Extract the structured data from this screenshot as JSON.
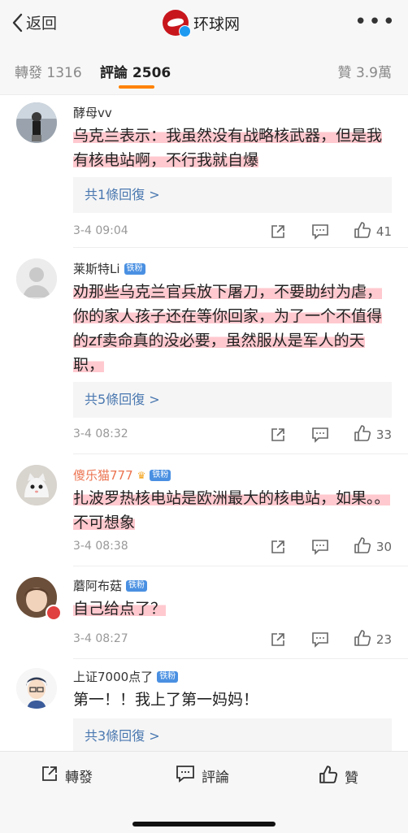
{
  "topbar": {
    "back_label": "返回",
    "brand": "环球网",
    "more": "•••"
  },
  "tabs": {
    "repost": "轉發 1316",
    "comments": "評論 2506",
    "likes": "贊 3.9萬"
  },
  "comments": [
    {
      "user": "酵母vv",
      "text": "乌克兰表示：我虽然没有战略核武器，但是我有核电站啊，不行我就自爆",
      "replies": "共1條回復 >",
      "time": "3-4 09:04",
      "likes": "41"
    },
    {
      "user": "莱斯特Li",
      "badge": "铁粉",
      "text": "劝那些乌克兰官兵放下屠刀，不要助纣为虐，你的家人孩子还在等你回家，为了一个不值得的zf卖命真的没必要，虽然服从是军人的天职，",
      "replies": "共5條回復 >",
      "time": "3-4 08:32",
      "likes": "33"
    },
    {
      "user": "傻乐猫777",
      "badge": "铁粉",
      "text": "扎波罗热核电站是欧洲最大的核电站，如果。。不可想象",
      "time": "3-4 08:38",
      "likes": "30"
    },
    {
      "user": "蘑阿布菇",
      "badge": "铁粉",
      "text": "自己给点了？",
      "time": "3-4 08:27",
      "likes": "23"
    },
    {
      "user": "上证7000点了",
      "badge": "铁粉",
      "text": "第一！！我上了第一妈妈！",
      "replies": "共3條回復 >"
    }
  ],
  "bottombar": {
    "repost": "轉發",
    "comment": "評論",
    "like": "贊"
  }
}
